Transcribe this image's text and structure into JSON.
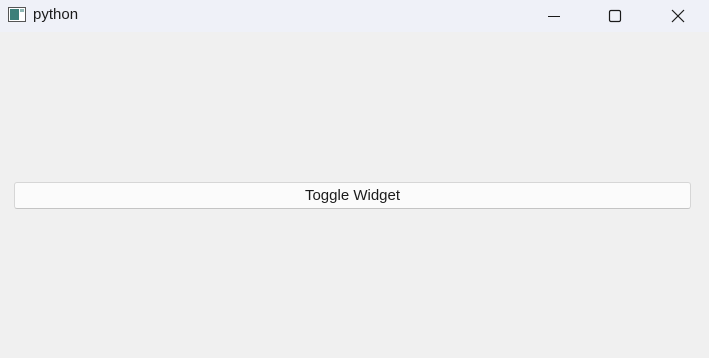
{
  "window": {
    "title": "python",
    "icon": "python-app-icon"
  },
  "titlebar_controls": {
    "minimize_icon": "minimize-icon",
    "maximize_icon": "maximize-icon",
    "close_icon": "close-icon"
  },
  "main": {
    "toggle_button_label": "Toggle Widget"
  },
  "colors": {
    "titlebar_bg": "#eff1f8",
    "window_bg": "#f0f0f0",
    "button_bg": "#fbfbfb",
    "button_border": "#d6d6d6"
  }
}
